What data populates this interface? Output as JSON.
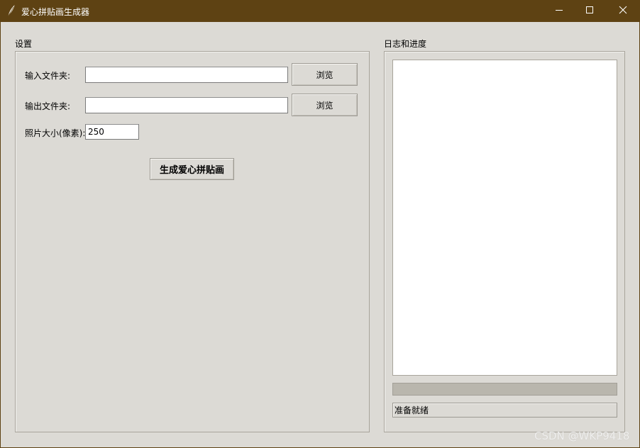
{
  "window": {
    "title": "爱心拼贴画生成器",
    "icon": "feather-icon",
    "controls": {
      "minimize": "minimize-icon",
      "maximize": "maximize-icon",
      "close": "close-icon"
    },
    "titlebar_color": "#5e4213",
    "background_color": "#dcdad5"
  },
  "settings": {
    "group_label": "设置",
    "input_folder": {
      "label": "输入文件夹:",
      "value": "",
      "browse_label": "浏览"
    },
    "output_folder": {
      "label": "输出文件夹:",
      "value": "",
      "browse_label": "浏览"
    },
    "photo_size": {
      "label": "照片大小(像素):",
      "value": "250"
    },
    "generate_label": "生成爱心拼贴画"
  },
  "log": {
    "group_label": "日志和进度",
    "text": "",
    "progress": 0,
    "status_text": "准备就绪"
  },
  "watermark": "CSDN @WKP9418"
}
